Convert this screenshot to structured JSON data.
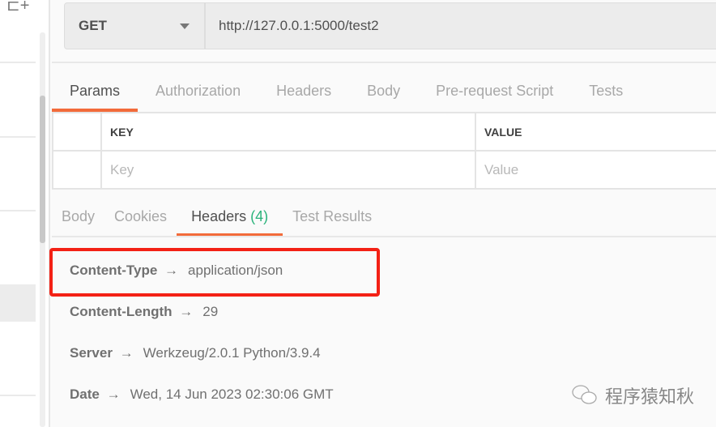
{
  "request": {
    "method": "GET",
    "url": "http://127.0.0.1:5000/test2"
  },
  "request_tabs": [
    {
      "label": "Params",
      "active": true
    },
    {
      "label": "Authorization"
    },
    {
      "label": "Headers"
    },
    {
      "label": "Body"
    },
    {
      "label": "Pre-request Script"
    },
    {
      "label": "Tests"
    }
  ],
  "params_table": {
    "key_header": "KEY",
    "value_header": "VALUE",
    "key_placeholder": "Key",
    "value_placeholder": "Value"
  },
  "response_tabs": [
    {
      "label": "Body"
    },
    {
      "label": "Cookies"
    },
    {
      "label": "Headers",
      "count": "(4)",
      "active": true
    },
    {
      "label": "Test Results"
    }
  ],
  "response_headers": [
    {
      "name": "Content-Type",
      "arrow": "→",
      "value": "application/json"
    },
    {
      "name": "Content-Length",
      "arrow": "→",
      "value": "29"
    },
    {
      "name": "Server",
      "arrow": "→",
      "value": "Werkzeug/2.0.1 Python/3.9.4"
    },
    {
      "name": "Date",
      "arrow": "→",
      "value": "Wed, 14 Jun 2023 02:30:06 GMT"
    }
  ],
  "watermark": "程序猿知秋",
  "colors": {
    "accent": "#f26b3a",
    "highlight_box": "#f32115",
    "count": "#2bb37b"
  }
}
